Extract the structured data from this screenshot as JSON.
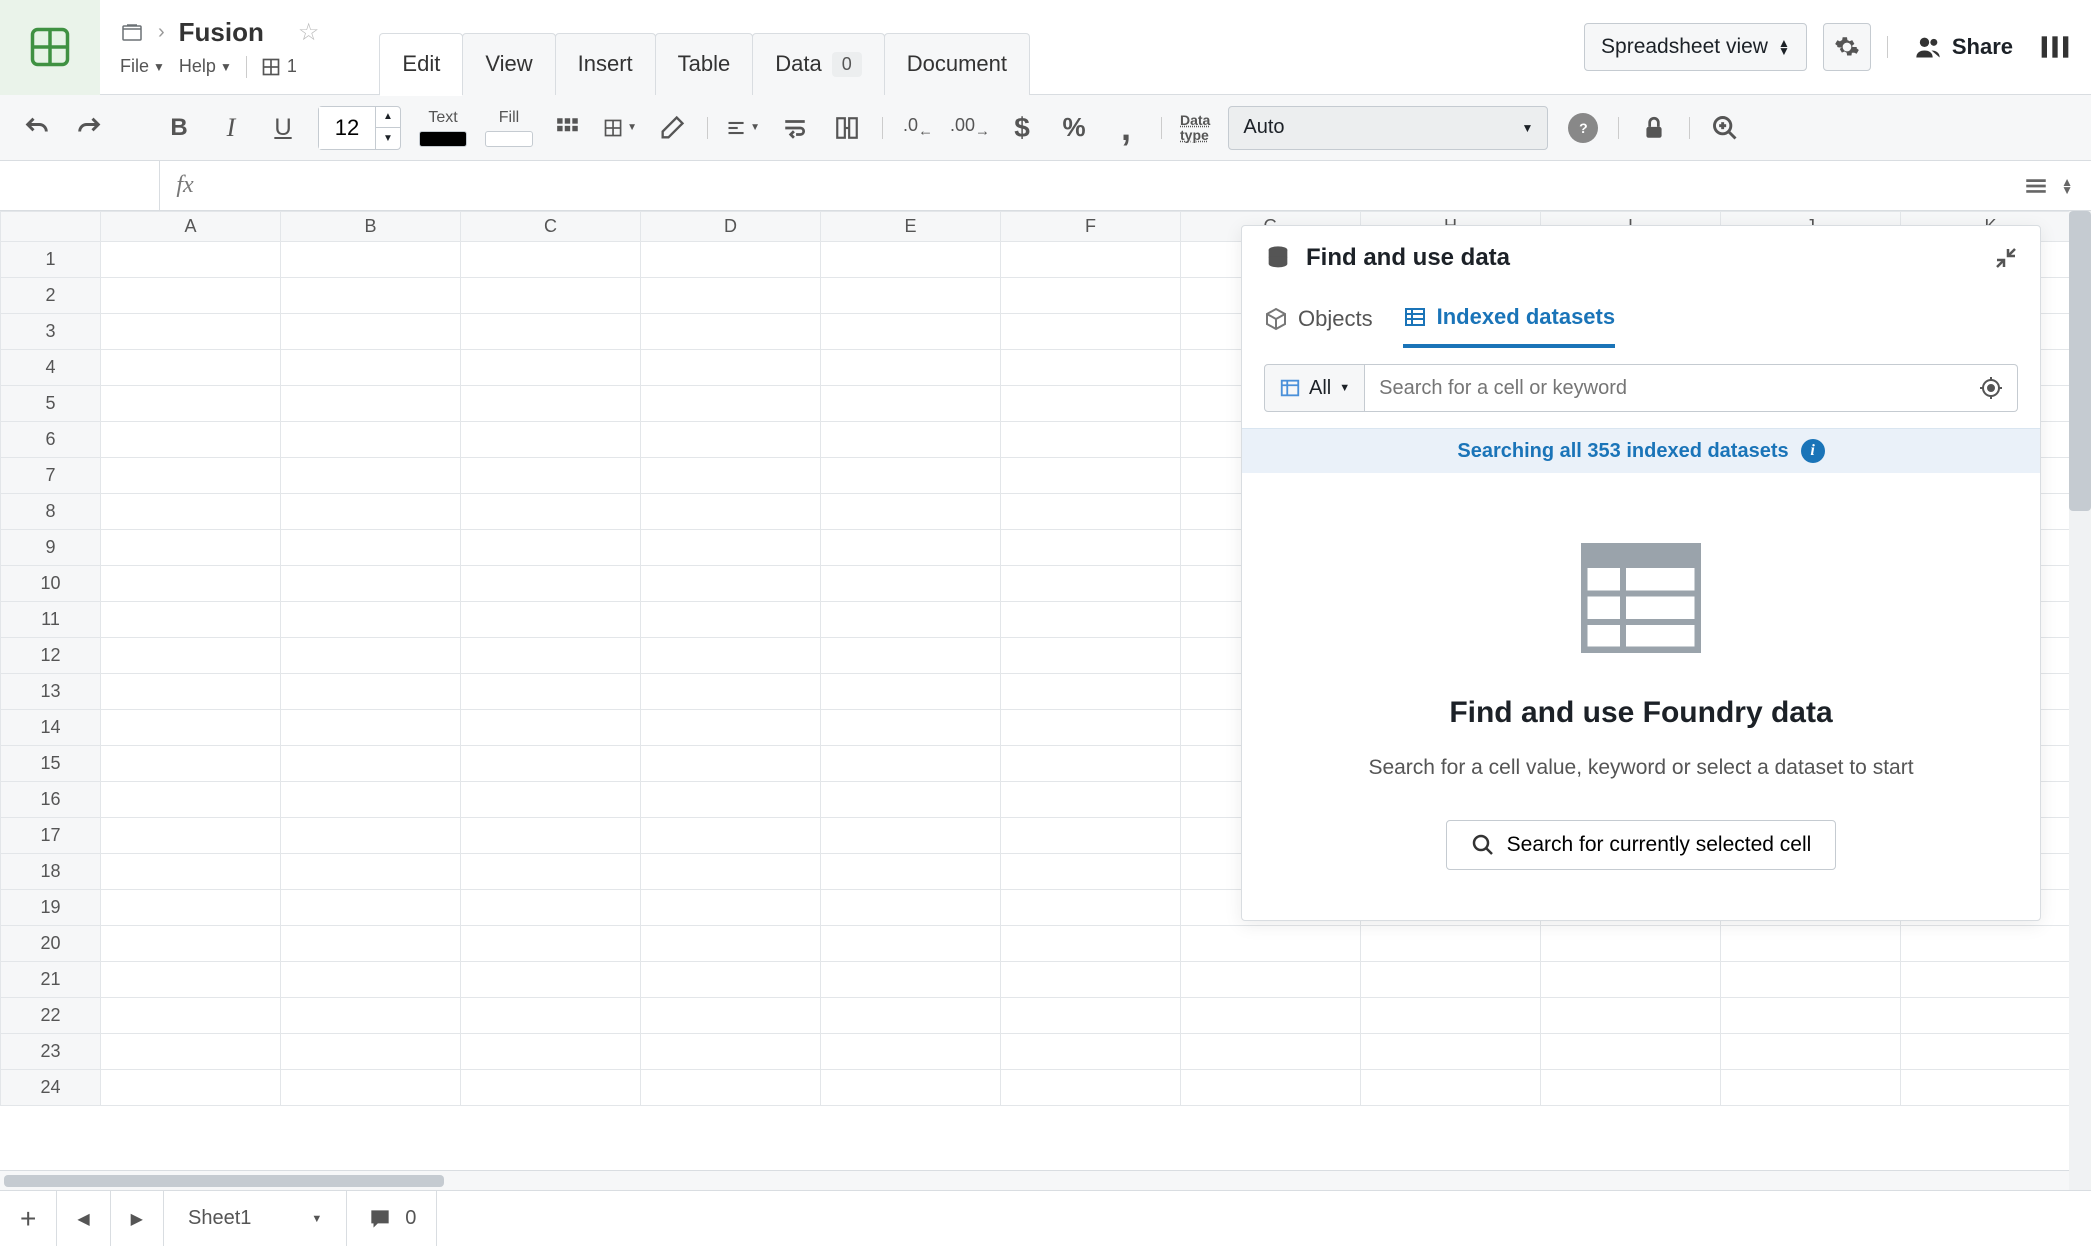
{
  "header": {
    "breadcrumb_title": "Fusion",
    "file_menu": "File",
    "help_menu": "Help",
    "sheet_count": "1",
    "view_selector": "Spreadsheet view",
    "share_label": "Share"
  },
  "tabs": {
    "items": [
      {
        "label": "Edit",
        "active": true
      },
      {
        "label": "View"
      },
      {
        "label": "Insert"
      },
      {
        "label": "Table"
      },
      {
        "label": "Data",
        "badge": "0"
      },
      {
        "label": "Document"
      }
    ]
  },
  "toolbar": {
    "font_size": "12",
    "text_label": "Text",
    "fill_label": "Fill",
    "text_color": "#000000",
    "fill_color": "#ffffff",
    "data_type_label_line1": "Data",
    "data_type_label_line2": "type",
    "data_type_value": "Auto"
  },
  "formula_bar": {
    "fx": "fx",
    "formula": ""
  },
  "grid": {
    "columns": [
      "A",
      "B",
      "C",
      "D",
      "E",
      "F",
      "G",
      "H",
      "I",
      "J",
      "K"
    ],
    "row_count": 24
  },
  "panel": {
    "title": "Find and use data",
    "tabs": {
      "objects": "Objects",
      "indexed": "Indexed datasets"
    },
    "filter_label": "All",
    "search_placeholder": "Search for a cell or keyword",
    "status_text": "Searching all 353 indexed datasets",
    "empty_title": "Find and use Foundry data",
    "empty_sub": "Search for a cell value, keyword or select a dataset to start",
    "search_cell_button": "Search for currently selected cell"
  },
  "bottombar": {
    "sheet_name": "Sheet1",
    "comment_count": "0"
  }
}
